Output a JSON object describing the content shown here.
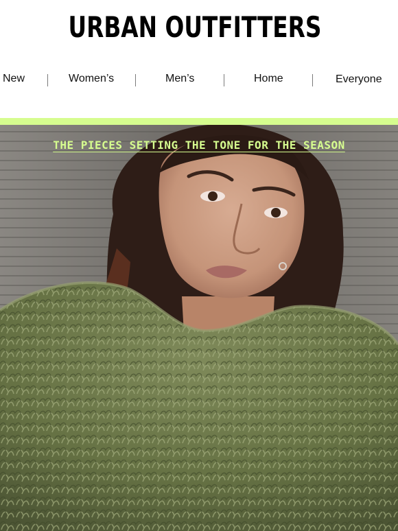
{
  "brand": {
    "logo_text": "URBAN OUTFITTERS"
  },
  "nav": {
    "items": [
      {
        "label": "New"
      },
      {
        "label": "Women’s"
      },
      {
        "label": "Men’s"
      },
      {
        "label": "Home"
      },
      {
        "label": "Everyone"
      }
    ]
  },
  "hero": {
    "tagline": "THE PIECES SETTING THE TONE FOR THE SEASON",
    "image_subject": "model-in-green-shaggy-coat"
  },
  "colors": {
    "accent": "#d6fd8f",
    "text": "#111111",
    "background": "#ffffff"
  }
}
